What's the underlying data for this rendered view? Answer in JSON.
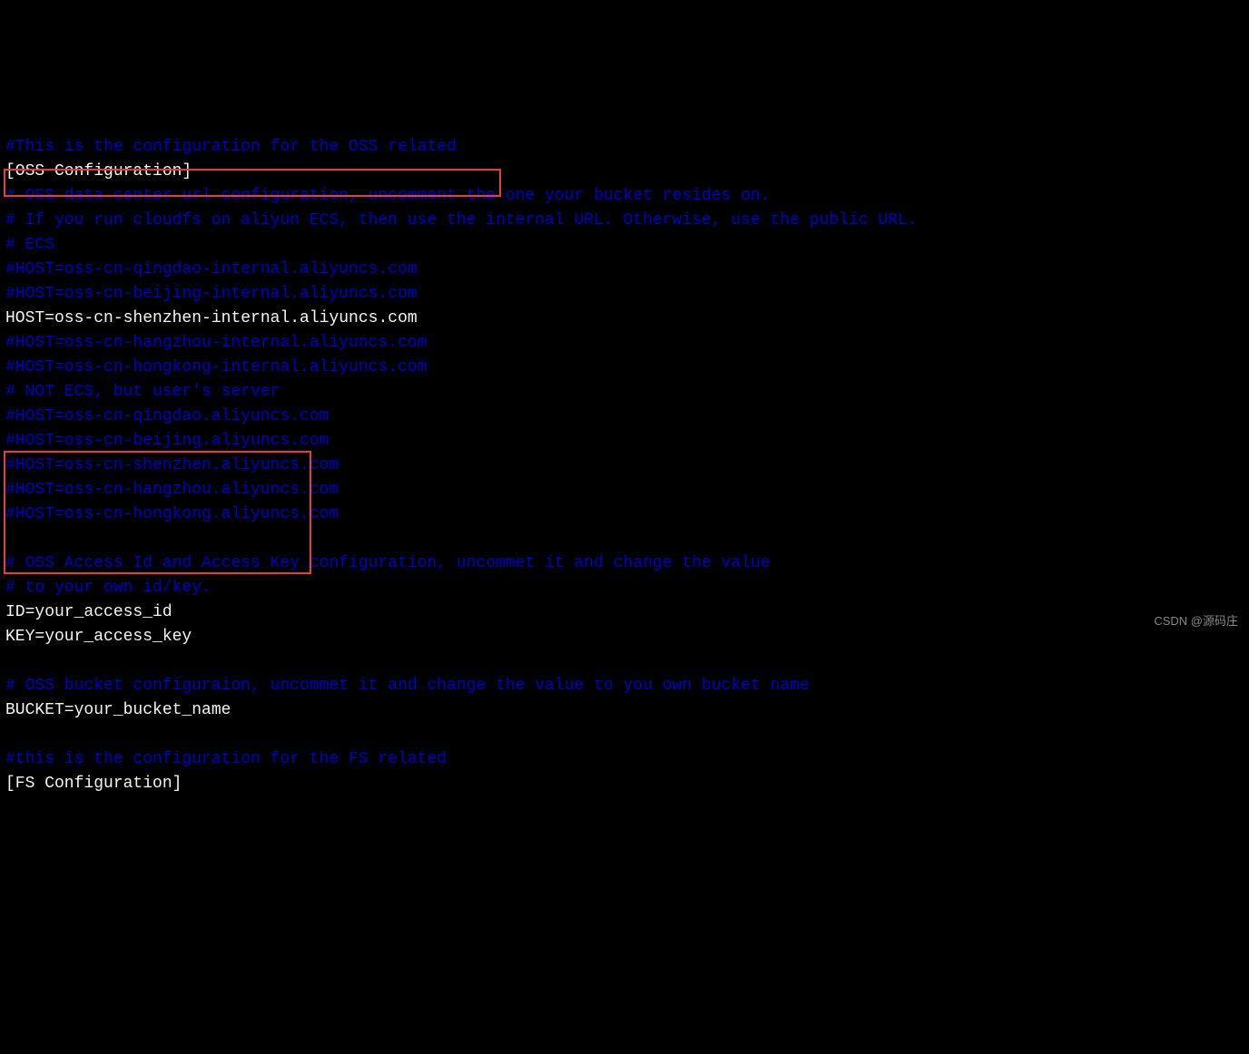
{
  "lines": {
    "l1": "#This is the configuration for the OSS related",
    "l2": "[OSS Configuration]",
    "l3": "# OSS data center url configuration, uncomment the one your bucket resides on.",
    "l4": "# If you run cloudfs on aliyun ECS, then use the internal URL. Otherwise, use the public URL.",
    "l5": "# ECS",
    "l6": "#HOST=oss-cn-qingdao-internal.aliyuncs.com",
    "l7": "#HOST=oss-cn-beijing-internal.aliyuncs.com",
    "l8": "HOST=oss-cn-shenzhen-internal.aliyuncs.com",
    "l9": "#HOST=oss-cn-hangzhou-internal.aliyuncs.com",
    "l10": "#HOST=oss-cn-hongkong-internal.aliyuncs.com",
    "l11": "# NOT ECS, but user's server",
    "l12": "#HOST=oss-cn-qingdao.aliyuncs.com",
    "l13": "#HOST=oss-cn-beijing.aliyuncs.com",
    "l14": "#HOST=oss-cn-shenzhen.aliyuncs.com",
    "l15": "#HOST=oss-cn-hangzhou.aliyuncs.com",
    "l16": "#HOST=oss-cn-hongkong.aliyuncs.com",
    "l17": " ",
    "l18": "# OSS Access Id and Access Key configuration, uncommet it and change the value",
    "l19": "# to your own id/key.",
    "l20": "ID=your_access_id",
    "l21": "KEY=your_access_key",
    "l22": " ",
    "l23": "# OSS bucket configuraion, uncommet it and change the value to you own bucket name",
    "l24": "BUCKET=your_bucket_name",
    "l25": " ",
    "l26": "#this is the configuration for the FS related",
    "l27": "[FS Configuration]"
  },
  "watermark": "CSDN @源码庄"
}
